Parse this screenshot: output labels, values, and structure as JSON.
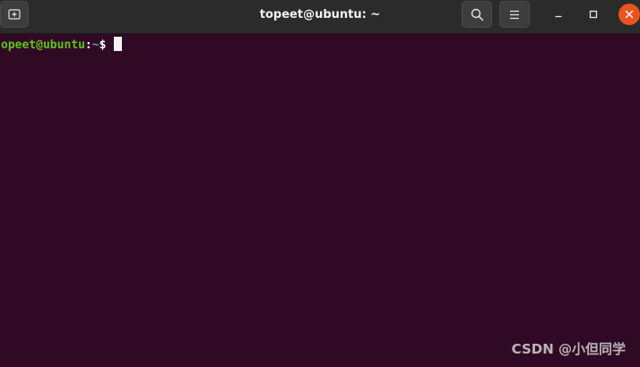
{
  "window": {
    "title": "topeet@ubuntu: ~"
  },
  "titlebar": {
    "new_tab_icon": "new-tab-icon",
    "search_icon": "search-icon",
    "menu_icon": "hamburger-menu-icon",
    "minimize_icon": "minimize-icon",
    "maximize_icon": "maximize-icon",
    "close_icon": "close-icon"
  },
  "terminal": {
    "prompt_user": "opeet@ubuntu",
    "prompt_colon": ":",
    "prompt_path": "~",
    "prompt_symbol": "$ ",
    "command": ""
  },
  "colors": {
    "background": "#300a24",
    "titlebar": "#2b2b2b",
    "user": "#5ec21b",
    "path": "#6e8fd6",
    "close_button": "#e95420"
  },
  "watermark": {
    "text": "CSDN @小但同学"
  }
}
